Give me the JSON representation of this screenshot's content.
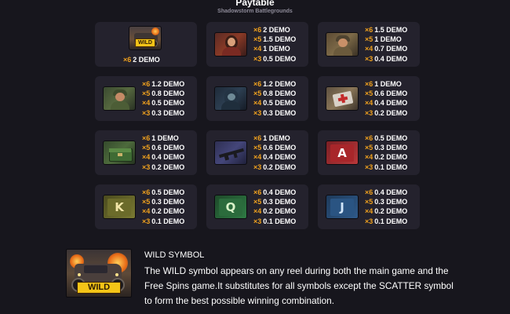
{
  "header": {
    "title": "Paytable",
    "subtitle": "Shadowstorm Battlegrounds"
  },
  "symbols": [
    {
      "id": "wild",
      "icon": "wild-truck-icon",
      "badge": "WILD",
      "pays": [
        {
          "mult": "×6",
          "amount": "2 DEMO"
        }
      ]
    },
    {
      "id": "woman-red",
      "icon": "woman-portrait-icon",
      "pays": [
        {
          "mult": "×6",
          "amount": "2 DEMO"
        },
        {
          "mult": "×5",
          "amount": "1.5 DEMO"
        },
        {
          "mult": "×4",
          "amount": "1 DEMO"
        },
        {
          "mult": "×3",
          "amount": "0.5 DEMO"
        }
      ]
    },
    {
      "id": "soldier-tan",
      "icon": "soldier-portrait-icon",
      "pays": [
        {
          "mult": "×6",
          "amount": "1.5 DEMO"
        },
        {
          "mult": "×5",
          "amount": "1 DEMO"
        },
        {
          "mult": "×4",
          "amount": "0.7 DEMO"
        },
        {
          "mult": "×3",
          "amount": "0.4 DEMO"
        }
      ]
    },
    {
      "id": "soldier-green",
      "icon": "soldier-green-portrait-icon",
      "pays": [
        {
          "mult": "×6",
          "amount": "1.2 DEMO"
        },
        {
          "mult": "×5",
          "amount": "0.8 DEMO"
        },
        {
          "mult": "×4",
          "amount": "0.5 DEMO"
        },
        {
          "mult": "×3",
          "amount": "0.3 DEMO"
        }
      ]
    },
    {
      "id": "hooded",
      "icon": "hooded-figure-icon",
      "pays": [
        {
          "mult": "×6",
          "amount": "1.2 DEMO"
        },
        {
          "mult": "×5",
          "amount": "0.8 DEMO"
        },
        {
          "mult": "×4",
          "amount": "0.5 DEMO"
        },
        {
          "mult": "×3",
          "amount": "0.3 DEMO"
        }
      ]
    },
    {
      "id": "medkit",
      "icon": "medkit-icon",
      "pays": [
        {
          "mult": "×6",
          "amount": "1 DEMO"
        },
        {
          "mult": "×5",
          "amount": "0.6 DEMO"
        },
        {
          "mult": "×4",
          "amount": "0.4 DEMO"
        },
        {
          "mult": "×3",
          "amount": "0.2 DEMO"
        }
      ]
    },
    {
      "id": "ammo-box",
      "icon": "ammo-box-icon",
      "pays": [
        {
          "mult": "×6",
          "amount": "1 DEMO"
        },
        {
          "mult": "×5",
          "amount": "0.6 DEMO"
        },
        {
          "mult": "×4",
          "amount": "0.4 DEMO"
        },
        {
          "mult": "×3",
          "amount": "0.2 DEMO"
        }
      ]
    },
    {
      "id": "rifle",
      "icon": "rifle-icon",
      "pays": [
        {
          "mult": "×6",
          "amount": "1 DEMO"
        },
        {
          "mult": "×5",
          "amount": "0.6 DEMO"
        },
        {
          "mult": "×4",
          "amount": "0.4 DEMO"
        },
        {
          "mult": "×3",
          "amount": "0.2 DEMO"
        }
      ]
    },
    {
      "id": "letter-a",
      "icon": "letter-a-icon",
      "letter": "A",
      "pays": [
        {
          "mult": "×6",
          "amount": "0.5 DEMO"
        },
        {
          "mult": "×5",
          "amount": "0.3 DEMO"
        },
        {
          "mult": "×4",
          "amount": "0.2 DEMO"
        },
        {
          "mult": "×3",
          "amount": "0.1 DEMO"
        }
      ]
    },
    {
      "id": "letter-k",
      "icon": "letter-k-icon",
      "letter": "K",
      "pays": [
        {
          "mult": "×6",
          "amount": "0.5 DEMO"
        },
        {
          "mult": "×5",
          "amount": "0.3 DEMO"
        },
        {
          "mult": "×4",
          "amount": "0.2 DEMO"
        },
        {
          "mult": "×3",
          "amount": "0.1 DEMO"
        }
      ]
    },
    {
      "id": "letter-q",
      "icon": "letter-q-icon",
      "letter": "Q",
      "pays": [
        {
          "mult": "×6",
          "amount": "0.4 DEMO"
        },
        {
          "mult": "×5",
          "amount": "0.3 DEMO"
        },
        {
          "mult": "×4",
          "amount": "0.2 DEMO"
        },
        {
          "mult": "×3",
          "amount": "0.1 DEMO"
        }
      ]
    },
    {
      "id": "letter-j",
      "icon": "letter-j-icon",
      "letter": "J",
      "pays": [
        {
          "mult": "×6",
          "amount": "0.4 DEMO"
        },
        {
          "mult": "×5",
          "amount": "0.3 DEMO"
        },
        {
          "mult": "×4",
          "amount": "0.2 DEMO"
        },
        {
          "mult": "×3",
          "amount": "0.1 DEMO"
        }
      ]
    }
  ],
  "wild_info": {
    "icon": "wild-truck-icon",
    "badge": "WILD",
    "heading": "WILD SYMBOL",
    "description": "The WILD symbol appears on any reel during both the main game and the Free Spins game.It substitutes for all symbols except the SCATTER symbol to form the best possible winning combination."
  },
  "colors": {
    "background": "#17161d",
    "card": "#24222d",
    "multiplier": "#f0a11e",
    "text": "#ffffff",
    "wild_badge": "#f4c417"
  }
}
